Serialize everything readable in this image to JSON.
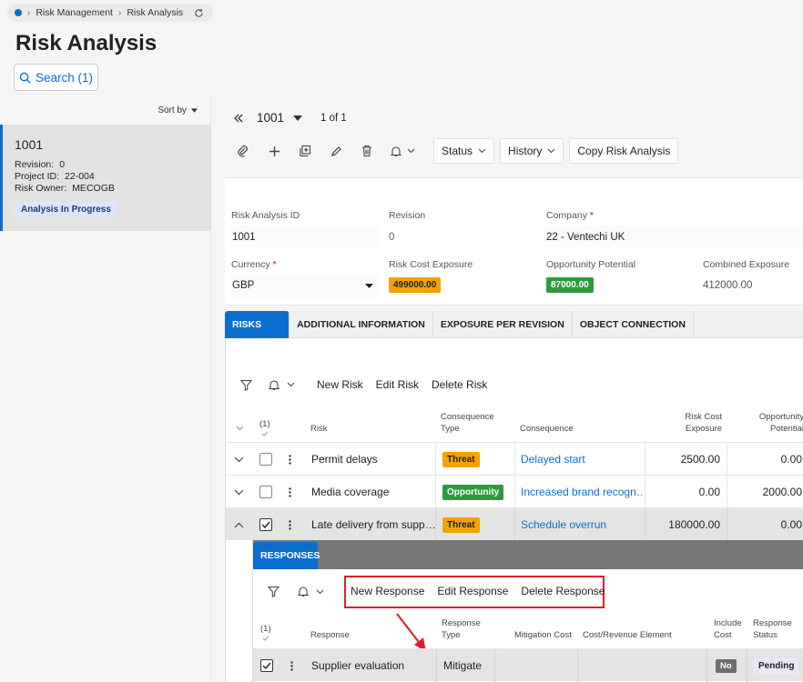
{
  "breadcrumb": {
    "items": [
      "Risk Management",
      "Risk Analysis"
    ]
  },
  "page_title": "Risk Analysis",
  "search": {
    "label": "Search (1)"
  },
  "list": {
    "sort_label": "Sort by",
    "card": {
      "id": "1001",
      "revision_label": "Revision:",
      "revision_value": "0",
      "project_label": "Project ID:",
      "project_value": "22-004",
      "owner_label": "Risk Owner:",
      "owner_value": "MECOGB",
      "status": "Analysis In Progress"
    }
  },
  "record_nav": {
    "current": "1001",
    "position": "1 of 1"
  },
  "toolbar": {
    "status_label": "Status",
    "history_label": "History",
    "copy_label": "Copy Risk Analysis"
  },
  "form": {
    "risk_analysis_id_label": "Risk Analysis ID",
    "risk_analysis_id": "1001",
    "revision_label": "Revision",
    "revision": "0",
    "company_label": "Company",
    "company": "22 - Ventechi UK",
    "currency_label": "Currency",
    "currency": "GBP",
    "risk_cost_exposure_label": "Risk Cost Exposure",
    "risk_cost_exposure": "499000.00",
    "opportunity_potential_label": "Opportunity Potential",
    "opportunity_potential": "87000.00",
    "combined_exposure_label": "Combined Exposure",
    "combined_exposure": "412000.00",
    "required_mark": "*",
    "colors": {
      "threat": "#f1a400",
      "opportunity": "#2f9a3c"
    }
  },
  "tabs": [
    "RISKS",
    "ADDITIONAL INFORMATION",
    "EXPOSURE PER REVISION",
    "OBJECT CONNECTION"
  ],
  "risks": {
    "actions": {
      "new": "New Risk",
      "edit": "Edit Risk",
      "delete": "Delete Risk"
    },
    "selected_count": "(1)",
    "headers": {
      "risk": "Risk",
      "consequence_type_1": "Consequence",
      "consequence_type_2": "Type",
      "consequence": "Consequence",
      "risk_cost_1": "Risk Cost",
      "risk_cost_2": "Exposure",
      "opp_1": "Opportunity",
      "opp_2": "Potential"
    },
    "rows": [
      {
        "risk": "Permit delays",
        "type": "Threat",
        "consequence": "Delayed start",
        "risk_cost": "2500.00",
        "opportunity": "0.00"
      },
      {
        "risk": "Media coverage",
        "type": "Opportunity",
        "consequence": "Increased brand recogn…",
        "risk_cost": "0.00",
        "opportunity": "2000.00"
      },
      {
        "risk": "Late delivery from supp…",
        "type": "Threat",
        "consequence": "Schedule overrun",
        "risk_cost": "180000.00",
        "opportunity": "0.00"
      }
    ]
  },
  "responses": {
    "tab": "RESPONSES",
    "actions": {
      "new": "New Response",
      "edit": "Edit Response",
      "delete": "Delete Response"
    },
    "selected_count": "(1)",
    "headers": {
      "response": "Response",
      "type_1": "Response",
      "type_2": "Type",
      "mitigation_cost": "Mitigation Cost",
      "cost_element": "Cost/Revenue Element",
      "include_1": "Include",
      "include_2": "Cost",
      "status_1": "Response",
      "status_2": "Status"
    },
    "rows": [
      {
        "response": "Supplier evaluation",
        "type": "Mitigate",
        "include_cost": "No",
        "status": "Pending"
      }
    ]
  }
}
